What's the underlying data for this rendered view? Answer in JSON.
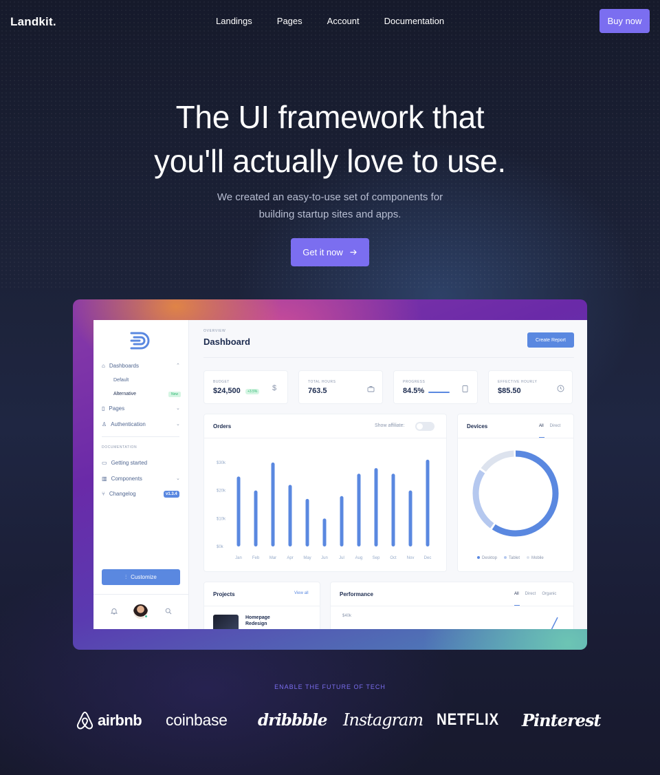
{
  "nav": {
    "logo": "Landkit.",
    "links": [
      "Landings",
      "Pages",
      "Account",
      "Documentation"
    ],
    "buy_label": "Buy now"
  },
  "hero": {
    "title_line1": "The UI framework that",
    "title_line2": "you'll actually love to use.",
    "subtitle_line1": "We created an easy-to-use set of components for",
    "subtitle_line2": "building startup sites and apps.",
    "cta_label": "Get it now",
    "accent": "#7b6ef0"
  },
  "dashboard": {
    "sidebar": {
      "dashboards": "Dashboards",
      "default": "Default",
      "alternative": "Alternative",
      "new_badge": "New",
      "pages": "Pages",
      "authentication": "Authentication",
      "documentation_heading": "DOCUMENTATION",
      "getting_started": "Getting started",
      "components": "Components",
      "changelog": "Changelog",
      "version": "v1.3.4",
      "customize": "Customize"
    },
    "overview": "OVERVIEW",
    "title": "Dashboard",
    "create_report": "Create Report",
    "stats": [
      {
        "label": "BUDGET",
        "value": "$24,500",
        "delta": "+3.5%",
        "icon": "$"
      },
      {
        "label": "TOTAL HOURS",
        "value": "763.5",
        "icon": "briefcase-icon"
      },
      {
        "label": "PROGRESS",
        "value": "84.5%",
        "icon": "clipboard-icon",
        "progress": 0.845
      },
      {
        "label": "EFFECTIVE HOURLY",
        "value": "$85.50",
        "icon": "clock-icon"
      }
    ],
    "orders": {
      "title": "Orders",
      "affiliate": "Show affiliate:"
    },
    "devices": {
      "title": "Devices",
      "tabs": [
        "All",
        "Direct"
      ],
      "legend": [
        "Desktop",
        "Tablet",
        "Mobile"
      ]
    },
    "projects": {
      "title": "Projects",
      "view_all": "View all",
      "item": "Homepage Redesign"
    },
    "performance": {
      "title": "Performance",
      "tabs": [
        "All",
        "Direct",
        "Organic"
      ],
      "ytick": "$40k"
    }
  },
  "chart_data": [
    {
      "type": "bar",
      "title": "Orders",
      "categories": [
        "Jan",
        "Feb",
        "Mar",
        "Apr",
        "May",
        "Jun",
        "Jul",
        "Aug",
        "Sep",
        "Oct",
        "Nov",
        "Dec"
      ],
      "values": [
        25,
        20,
        30,
        22,
        17,
        10,
        18,
        26,
        28,
        26,
        20,
        31
      ],
      "yticks": [
        "$0k",
        "$10k",
        "$20k",
        "$30k"
      ],
      "ylim": [
        0,
        30
      ],
      "grid": false,
      "color": "#5a88e0"
    },
    {
      "type": "pie",
      "title": "Devices",
      "categories": [
        "Desktop",
        "Tablet",
        "Mobile"
      ],
      "values": [
        60,
        25,
        15
      ],
      "colors": [
        "#5a88e0",
        "#b5c8ef",
        "#dde3ee"
      ]
    }
  ],
  "logos": {
    "eyebrow": "ENABLE THE FUTURE OF TECH",
    "brands": [
      "airbnb",
      "coinbase",
      "dribbble",
      "Instagram",
      "NETFLIX",
      "Pinterest"
    ]
  }
}
